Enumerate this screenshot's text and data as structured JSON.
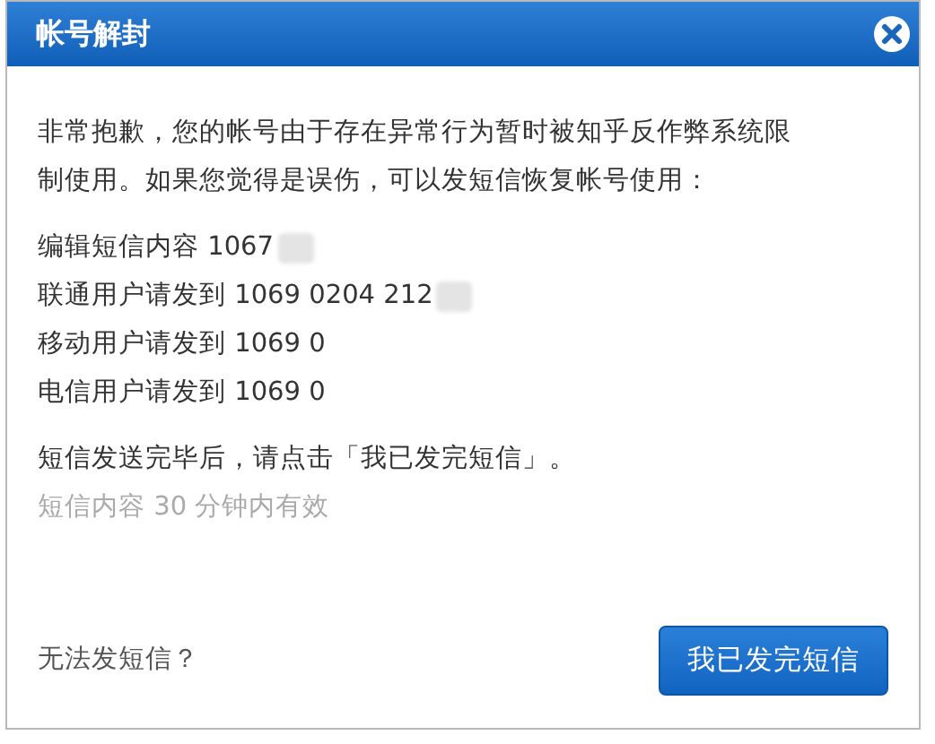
{
  "dialog": {
    "title": "帐号解封",
    "message": "非常抱歉，您的帐号由于存在异常行为暂时被知乎反作弊系统限制使用。如果您觉得是误伤，可以发短信恢复帐号使用：",
    "sms_lines": [
      {
        "text": "编辑短信内容 1067",
        "redacted": true
      },
      {
        "text": "联通用户请发到 1069 0204 212",
        "redacted": true
      },
      {
        "text": "移动用户请发到 1069 0",
        "redacted": false
      },
      {
        "text": "电信用户请发到 1069 0",
        "redacted": false
      }
    ],
    "instruction": "短信发送完毕后，请点击「我已发完短信」。",
    "note": "短信内容 30 分钟内有效",
    "help_link": "无法发短信？",
    "confirm_button": "我已发完短信"
  }
}
